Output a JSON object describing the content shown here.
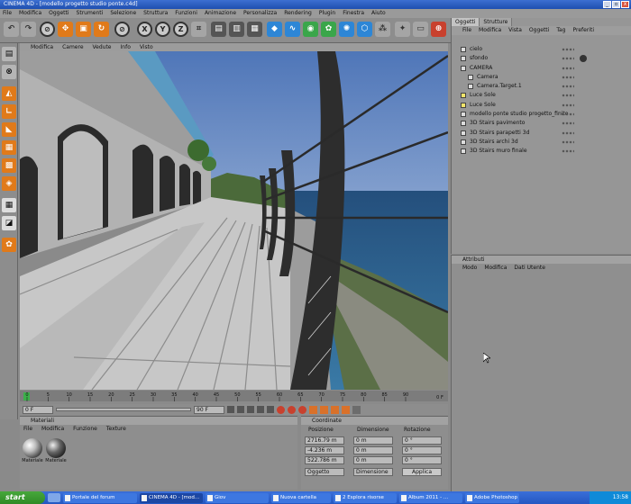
{
  "window": {
    "title": "CINEMA 4D - [modello progetto studio ponte.c4d]",
    "buttons": [
      "_",
      "▫",
      "x"
    ]
  },
  "menubar": [
    "File",
    "Modifica",
    "Oggetti",
    "Strumenti",
    "Selezione",
    "Struttura",
    "Funzioni",
    "Animazione",
    "Personalizza",
    "Rendering",
    "Plugin",
    "Finestra",
    "Aiuto"
  ],
  "toolbar": {
    "axis_x": "X",
    "axis_y": "Y",
    "axis_z": "Z"
  },
  "viewport": {
    "menu": [
      "Modifica",
      "Camere",
      "Vedute",
      "Info",
      "Visto"
    ]
  },
  "timeline": {
    "ticks": [
      "0",
      "5",
      "10",
      "15",
      "20",
      "25",
      "30",
      "35",
      "40",
      "45",
      "50",
      "55",
      "60",
      "65",
      "70",
      "75",
      "80",
      "85",
      "90"
    ],
    "frame_end": "0 F",
    "fields": [
      "0 F",
      "90 F"
    ],
    "playhead_frame": 0
  },
  "materials": {
    "title": "Materiali",
    "menu": [
      "File",
      "Modifica",
      "Funzione",
      "Texture"
    ],
    "items": [
      {
        "label": "Materiale"
      },
      {
        "label": "Materiale"
      }
    ]
  },
  "coordinates": {
    "title": "Coordinate",
    "headers": [
      "Posizione",
      "Dimensione",
      "Rotazione"
    ],
    "rows": [
      {
        "pos": "2716.79 m",
        "dim": "0 m",
        "rot": "0 °"
      },
      {
        "pos": "-4.236 m",
        "dim": "0 m",
        "rot": "0 °"
      },
      {
        "pos": "522.786 m",
        "dim": "0 m",
        "rot": "0 °"
      }
    ],
    "mode_select": "Oggetto",
    "size_select": "Dimensione",
    "apply_label": "Applica"
  },
  "object_manager": {
    "tabs": [
      "Oggetti",
      "Strutture"
    ],
    "menu": [
      "File",
      "Modifica",
      "Vista",
      "Oggetti",
      "Tag",
      "Preferiti"
    ],
    "items": [
      {
        "name": "cielo",
        "indent": 0,
        "icon_color": "#ffffff"
      },
      {
        "name": "sfondo",
        "indent": 0,
        "icon_color": "#ffffff"
      },
      {
        "name": "CAMERA",
        "indent": 0,
        "icon_color": "#ffffff"
      },
      {
        "name": "Camera",
        "indent": 1,
        "icon_color": "#ffffff"
      },
      {
        "name": "Camera.Target.1",
        "indent": 1,
        "icon_color": "#ffffff"
      },
      {
        "name": "Luce Sole",
        "indent": 0,
        "icon_color": "#f2e56a"
      },
      {
        "name": "Luce Sole",
        "indent": 0,
        "icon_color": "#f2e56a"
      },
      {
        "name": "modello ponte studio progetto_finito",
        "indent": 0,
        "icon_color": "#ffffff"
      },
      {
        "name": "3D Stairs pavimento",
        "indent": 0,
        "icon_color": "#ffffff"
      },
      {
        "name": "3D Stairs parapetti 3d",
        "indent": 0,
        "icon_color": "#ffffff"
      },
      {
        "name": "3D Stairs archi 3d",
        "indent": 0,
        "icon_color": "#ffffff"
      },
      {
        "name": "3D Stairs muro finale",
        "indent": 0,
        "icon_color": "#ffffff"
      }
    ]
  },
  "attributes": {
    "title": "Attributi",
    "menu": [
      "Modo",
      "Modifica",
      "Dati Utente"
    ]
  },
  "taskbar": {
    "start_label": "start",
    "tasks": [
      {
        "label": "Portale del forum",
        "active": false
      },
      {
        "label": "CINEMA 4D - [mod...",
        "active": true
      },
      {
        "label": "Giov",
        "active": false
      },
      {
        "label": "Nuova cartella",
        "active": false
      },
      {
        "label": "2 Esplora risorse",
        "active": false
      },
      {
        "label": "Album 2011 - ...",
        "active": false
      },
      {
        "label": "Adobe Photoshop",
        "active": false
      }
    ],
    "clock": "13:58"
  },
  "colors": {
    "toolbar_orange": "#e07a1a",
    "panel_grey": "#8e8e8e",
    "taskbar_blue": "#2457c2",
    "start_green": "#3a9a2f"
  }
}
